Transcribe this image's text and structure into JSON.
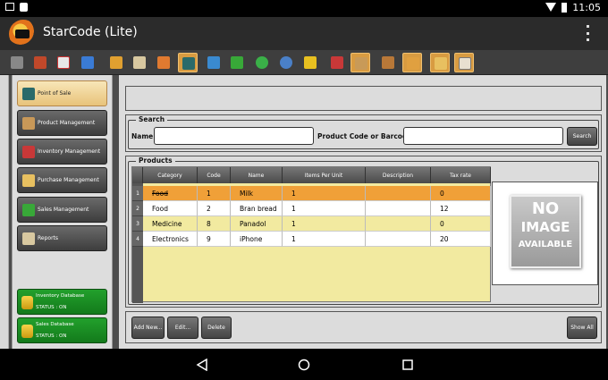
{
  "status_bar": {
    "time": "11:05"
  },
  "app": {
    "title": "StarCode (Lite)"
  },
  "sidebar": {
    "items": [
      {
        "label": "Point of Sale"
      },
      {
        "label": "Product Management"
      },
      {
        "label": "Inventory Management"
      },
      {
        "label": "Purchase Management"
      },
      {
        "label": "Sales Management"
      },
      {
        "label": "Reports"
      }
    ],
    "databases": [
      {
        "label": "Inventory Database",
        "status": "STATUS : ON"
      },
      {
        "label": "Sales Database",
        "status": "STATUS : ON"
      }
    ]
  },
  "search": {
    "title": "Search",
    "name_label": "Name",
    "name_value": "",
    "code_label": "Product Code or Barcode",
    "code_value": "",
    "button": "Search"
  },
  "products": {
    "title": "Products",
    "columns": [
      "Category",
      "Code",
      "Name",
      "Items Per Unit",
      "Description",
      "Tax rate"
    ],
    "rows": [
      {
        "num": "1",
        "category": "Food",
        "code": "1",
        "name": "Milk",
        "items": "1",
        "description": "",
        "tax": "0"
      },
      {
        "num": "2",
        "category": "Food",
        "code": "2",
        "name": "Bran bread",
        "items": "1",
        "description": "",
        "tax": "12"
      },
      {
        "num": "3",
        "category": "Medicine",
        "code": "8",
        "name": "Panadol",
        "items": "1",
        "description": "",
        "tax": "0"
      },
      {
        "num": "4",
        "category": "Electronics",
        "code": "9",
        "name": "iPhone",
        "items": "1",
        "description": "",
        "tax": "20"
      }
    ],
    "no_image": {
      "line1": "NO",
      "line2": "IMAGE",
      "line3": "AVAILABLE"
    }
  },
  "actions": {
    "add": "Add New...",
    "edit": "Edit...",
    "delete": "Delete",
    "show_all": "Show All"
  },
  "colors": {
    "selected_row": "#f0a038",
    "row_alt": "#f2eaa0",
    "row_white": "#ffffff",
    "accent": "#d89b41",
    "status_green": "#1a8f24"
  }
}
